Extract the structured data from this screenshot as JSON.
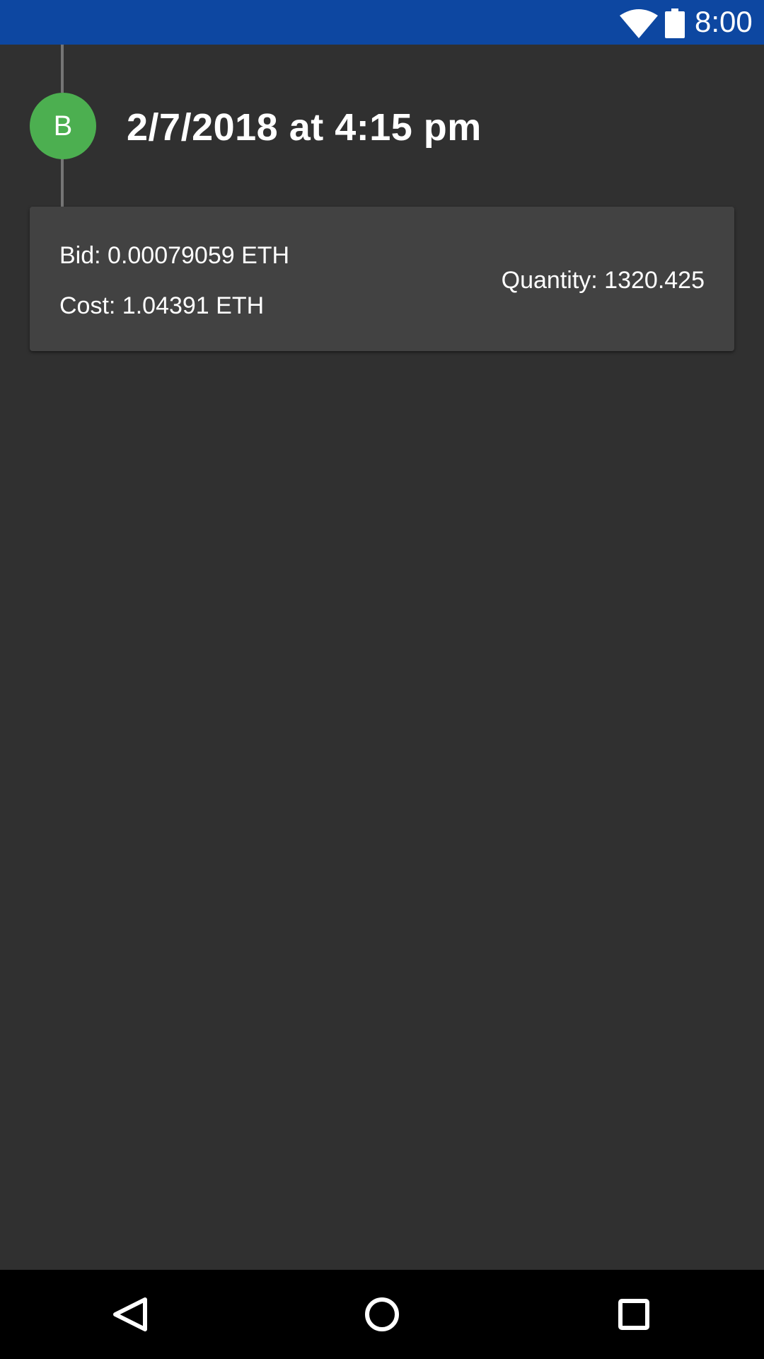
{
  "status_bar": {
    "time": "8:00",
    "icons": [
      "wifi-icon",
      "battery-icon"
    ],
    "color": "#0d47a1"
  },
  "trade": {
    "avatar_letter": "B",
    "avatar_color": "#4caf50",
    "timestamp": "2/7/2018 at 4:15 pm",
    "bid": "Bid: 0.00079059 ETH",
    "cost": "Cost: 1.04391 ETH",
    "quantity": "Quantity: 1320.425"
  },
  "nav_bar": {
    "buttons": [
      "back-icon",
      "home-icon",
      "recents-icon"
    ]
  }
}
